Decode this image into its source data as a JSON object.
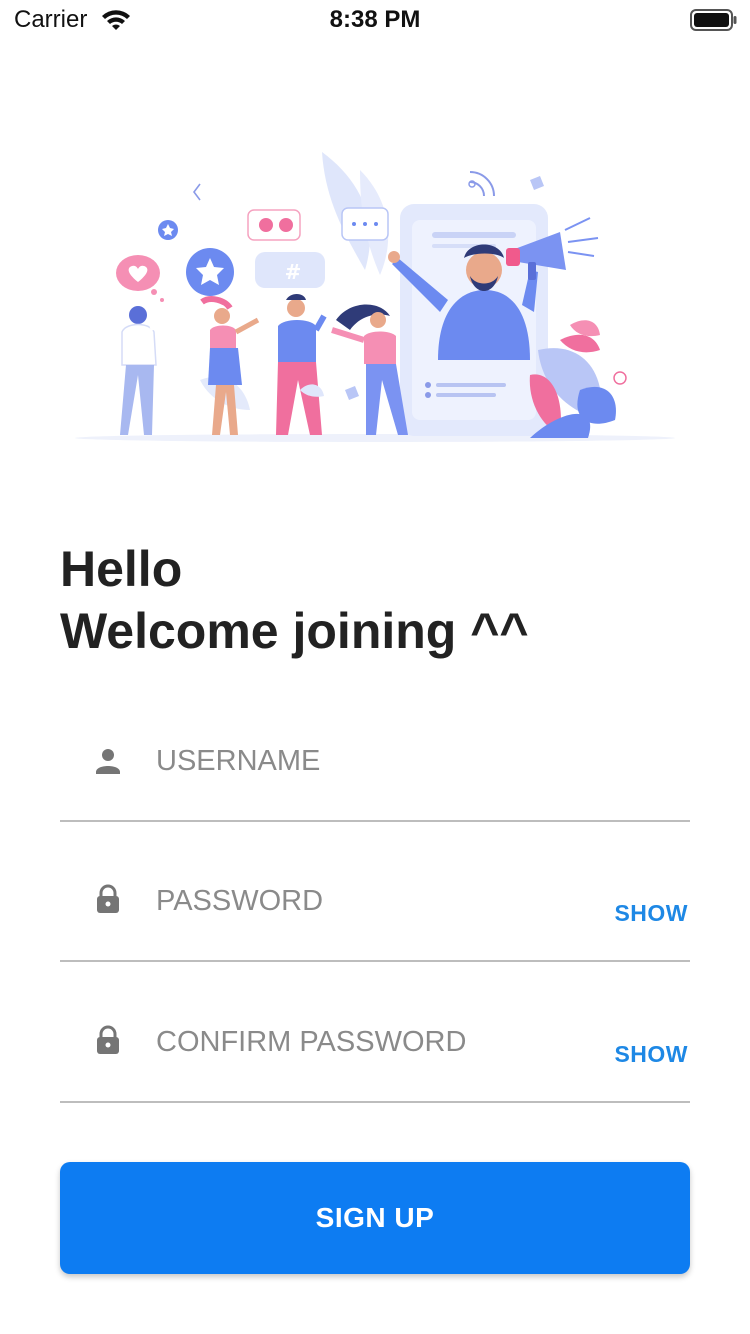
{
  "status_bar": {
    "carrier": "Carrier",
    "time": "8:38 PM",
    "wifi_icon": "wifi-icon",
    "battery_icon": "battery-icon"
  },
  "illustration": {
    "icon": "social-people-megaphone-illustration",
    "hashtag": "#"
  },
  "greeting": {
    "line1": "Hello",
    "line2": "Welcome joining ^^"
  },
  "form": {
    "username": {
      "placeholder": "USERNAME",
      "value": "",
      "icon": "person-icon"
    },
    "password": {
      "placeholder": "PASSWORD",
      "value": "",
      "icon": "lock-icon",
      "toggle_label": "SHOW"
    },
    "confirm_password": {
      "placeholder": "CONFIRM PASSWORD",
      "value": "",
      "icon": "lock-icon",
      "toggle_label": "SHOW"
    }
  },
  "signup_button": {
    "label": "SIGN UP"
  },
  "colors": {
    "accent": "#0d7cf2",
    "link": "#1e88e5",
    "text": "#222222",
    "placeholder": "#8a8a8a",
    "divider": "#bdbdbd"
  }
}
